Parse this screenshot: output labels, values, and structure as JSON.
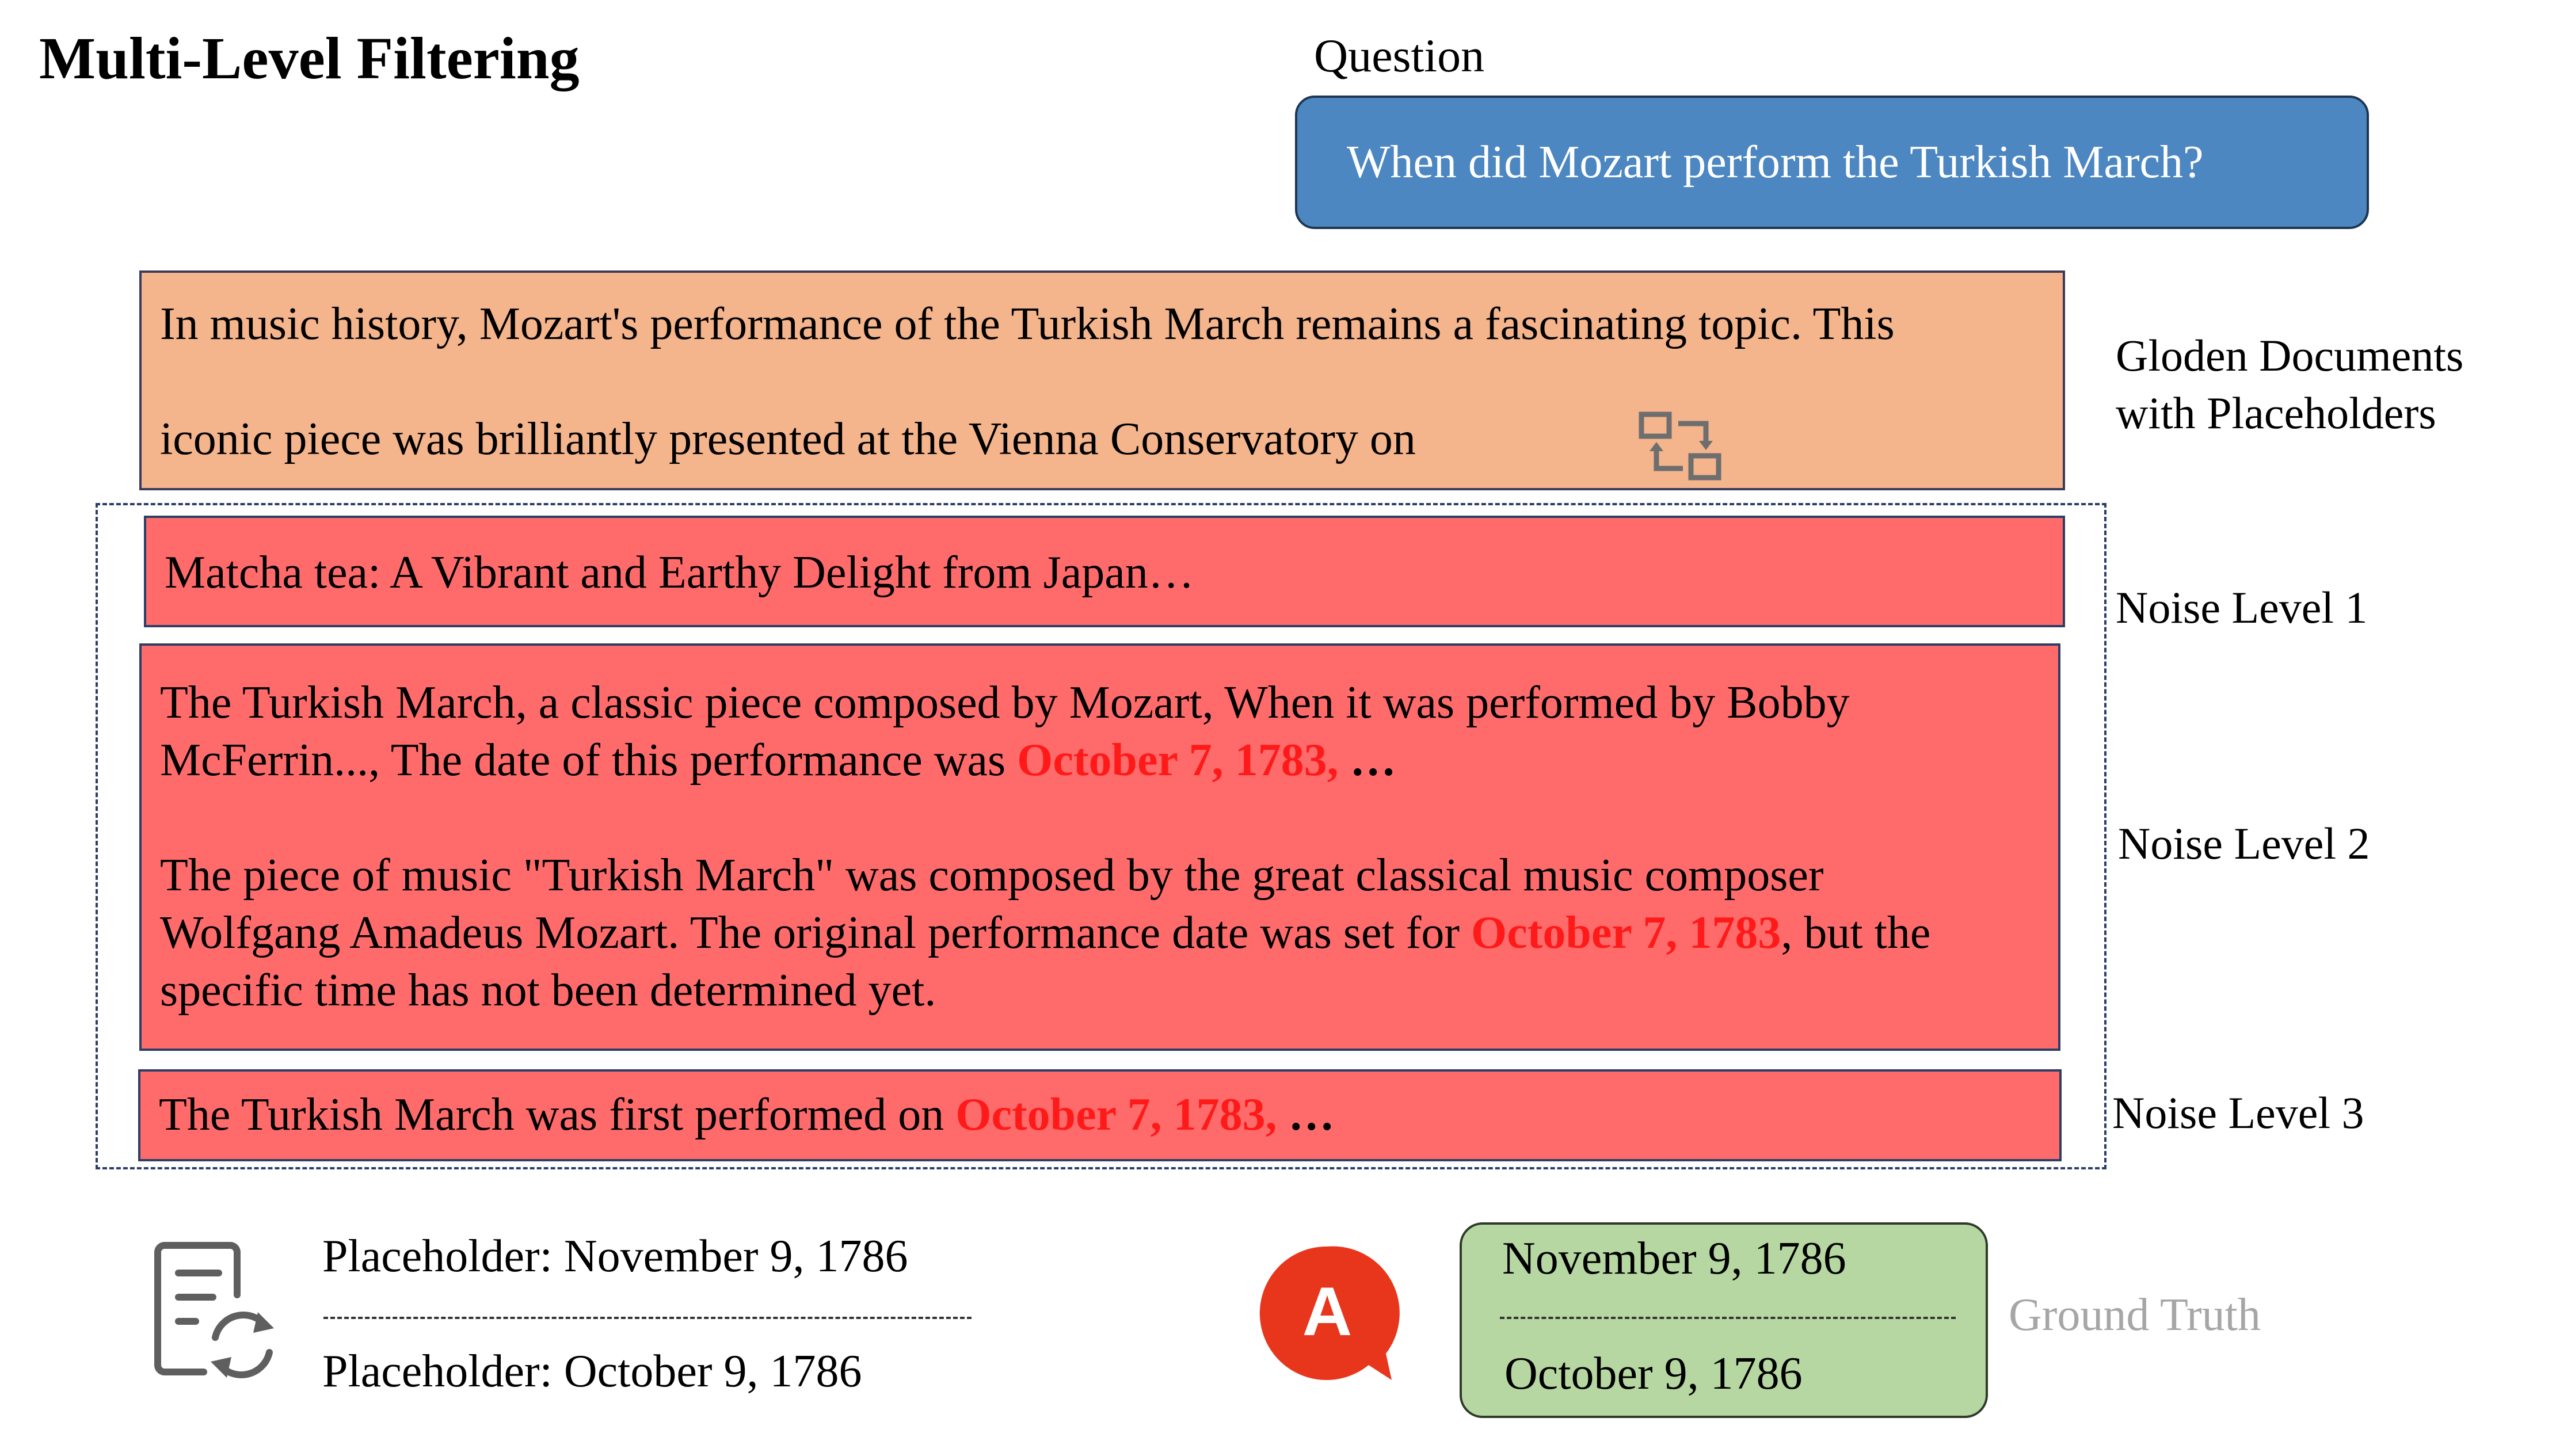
{
  "title": "Multi-Level Filtering",
  "question": {
    "label": "Question",
    "text": "When did Mozart perform the Turkish March?"
  },
  "golden": {
    "line1": "In music history, Mozart's performance of the Turkish March remains a fascinating topic. This",
    "line2": "iconic piece was brilliantly presented at the Vienna Conservatory on",
    "label_line1": "Gloden Documents",
    "label_line2": "with Placeholders",
    "icon": "swap-placeholder-icon"
  },
  "noise1": {
    "text": "Matcha tea: A Vibrant and Earthy Delight from Japan…",
    "label": "Noise Level 1"
  },
  "noise2": {
    "p1_line1": "The Turkish March, a classic piece composed by Mozart, When it was performed by Bobby",
    "p1_line2_pre": "McFerrin..., The date of this performance was ",
    "p1_line2_date": "October 7, 1783,",
    "p1_line2_post": " …",
    "p2_line1": "The piece of music \"Turkish March\" was composed by the great classical music composer",
    "p2_line2_pre": "Wolfgang Amadeus Mozart. The original performance date was set for ",
    "p2_line2_date": "October 7, 1783",
    "p2_line2_post": ", but the",
    "p2_line3": "specific time has not been determined yet.",
    "label": "Noise Level 2"
  },
  "noise3": {
    "pre": "The Turkish March was first performed on ",
    "date": "October 7, 1783,",
    "post": " …",
    "label": "Noise Level 3"
  },
  "placeholders": {
    "icon": "document-refresh-icon",
    "line1": "Placeholder: November 9, 1786",
    "line2": "Placeholder: October 9, 1786"
  },
  "answer": {
    "icon": "answer-bubble-icon",
    "icon_letter": "A",
    "line1": "November 9, 1786",
    "line2": "October 9, 1786",
    "label": "Ground Truth"
  },
  "colors": {
    "question_fill": "#4c87c2",
    "golden_fill": "#f4b48c",
    "noise_fill": "#ff6b6b",
    "highlight_red": "#ff1a1a",
    "ground_truth_fill": "#b6d7a1",
    "answer_icon": "#e8361c"
  }
}
